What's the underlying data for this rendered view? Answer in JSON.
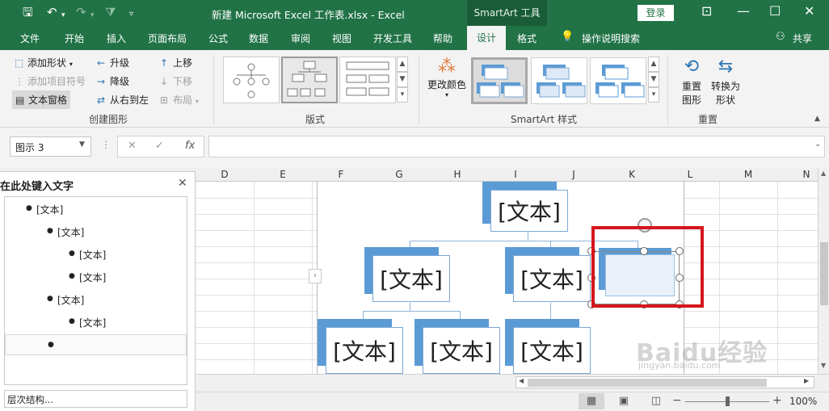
{
  "titlebar": {
    "title": "新建 Microsoft Excel 工作表.xlsx  -  Excel",
    "contextual_tab": "SmartArt 工具",
    "login": "登录"
  },
  "tabs": [
    "文件",
    "开始",
    "插入",
    "页面布局",
    "公式",
    "数据",
    "审阅",
    "视图",
    "开发工具",
    "帮助"
  ],
  "active_tab": "设计",
  "format_tab": "格式",
  "tell_me": "操作说明搜索",
  "share": "共享",
  "ribbon": {
    "create": {
      "add_shape": "添加形状",
      "add_bullet": "添加项目符号",
      "text_pane": "文本窗格",
      "promote": "升级",
      "demote": "降级",
      "rtl": "从右到左",
      "move_up": "上移",
      "move_down": "下移",
      "layout": "布局",
      "group_label": "创建图形"
    },
    "layouts_label": "版式",
    "change_colors": "更改颜色",
    "styles_label": "SmartArt 样式",
    "reset_graphic": "重置\n图形",
    "reset_graphic_l1": "重置",
    "reset_graphic_l2": "图形",
    "convert_l1": "转换为",
    "convert_l2": "形状",
    "reset_label": "重置"
  },
  "formula_bar": {
    "name_box": "图示 3",
    "value": ""
  },
  "columns": [
    "D",
    "E",
    "F",
    "G",
    "H",
    "I",
    "J",
    "K",
    "L",
    "M",
    "N"
  ],
  "smartart": {
    "node_text": "[文本]"
  },
  "text_pane": {
    "title": "在此处键入文字",
    "items": [
      {
        "level": 1,
        "text": "[文本]"
      },
      {
        "level": 2,
        "text": "[文本]"
      },
      {
        "level": 3,
        "text": "[文本]"
      },
      {
        "level": 3,
        "text": "[文本]"
      },
      {
        "level": 2,
        "text": "[文本]"
      },
      {
        "level": 3,
        "text": "[文本]"
      },
      {
        "level": 1,
        "text": ""
      }
    ],
    "footer": "层次结构..."
  },
  "status": {
    "zoom": "100%"
  },
  "watermark": {
    "brand": "Baidu经验",
    "url": "jingyan.baidu.com"
  },
  "colors": {
    "excel_green": "#217346",
    "node_blue": "#5b9bd5",
    "highlight_red": "#d4161c"
  }
}
